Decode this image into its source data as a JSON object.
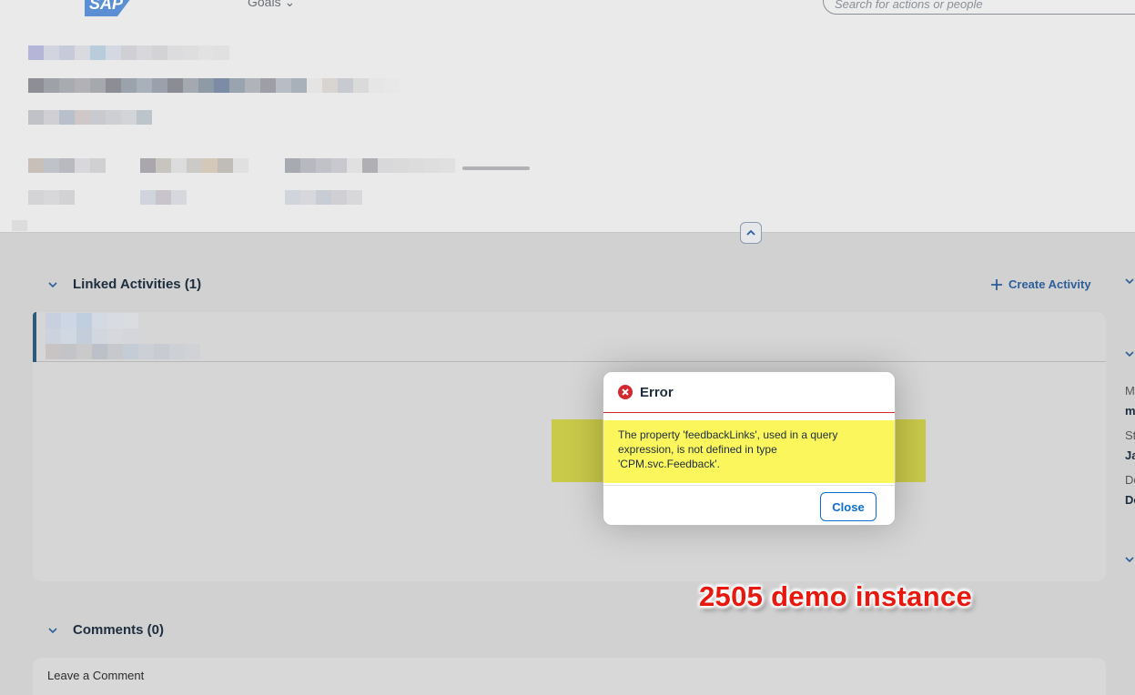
{
  "header": {
    "logo_text": "SAP",
    "nav_label": "Goals",
    "search_placeholder": "Search for actions or people"
  },
  "sections": {
    "linked_activities": {
      "title": "Linked Activities (1)",
      "create_label": "Create Activity"
    },
    "comments": {
      "title": "Comments (0)",
      "input_placeholder": "Leave a Comment"
    }
  },
  "right_panel": {
    "labels": [
      "M",
      "m",
      "St",
      "Ja",
      "De",
      "De"
    ]
  },
  "dialog": {
    "title": "Error",
    "message": "The property 'feedbackLinks', used in a query expression, is not defined in type 'CPM.svc.Feedback'.",
    "close_label": "Close"
  },
  "annotation": {
    "text": "2505 demo instance"
  },
  "colors": {
    "accent": "#0a6ed1",
    "error": "#d4282f",
    "highlight": "#fbf65c",
    "annotation": "#e8180f"
  }
}
